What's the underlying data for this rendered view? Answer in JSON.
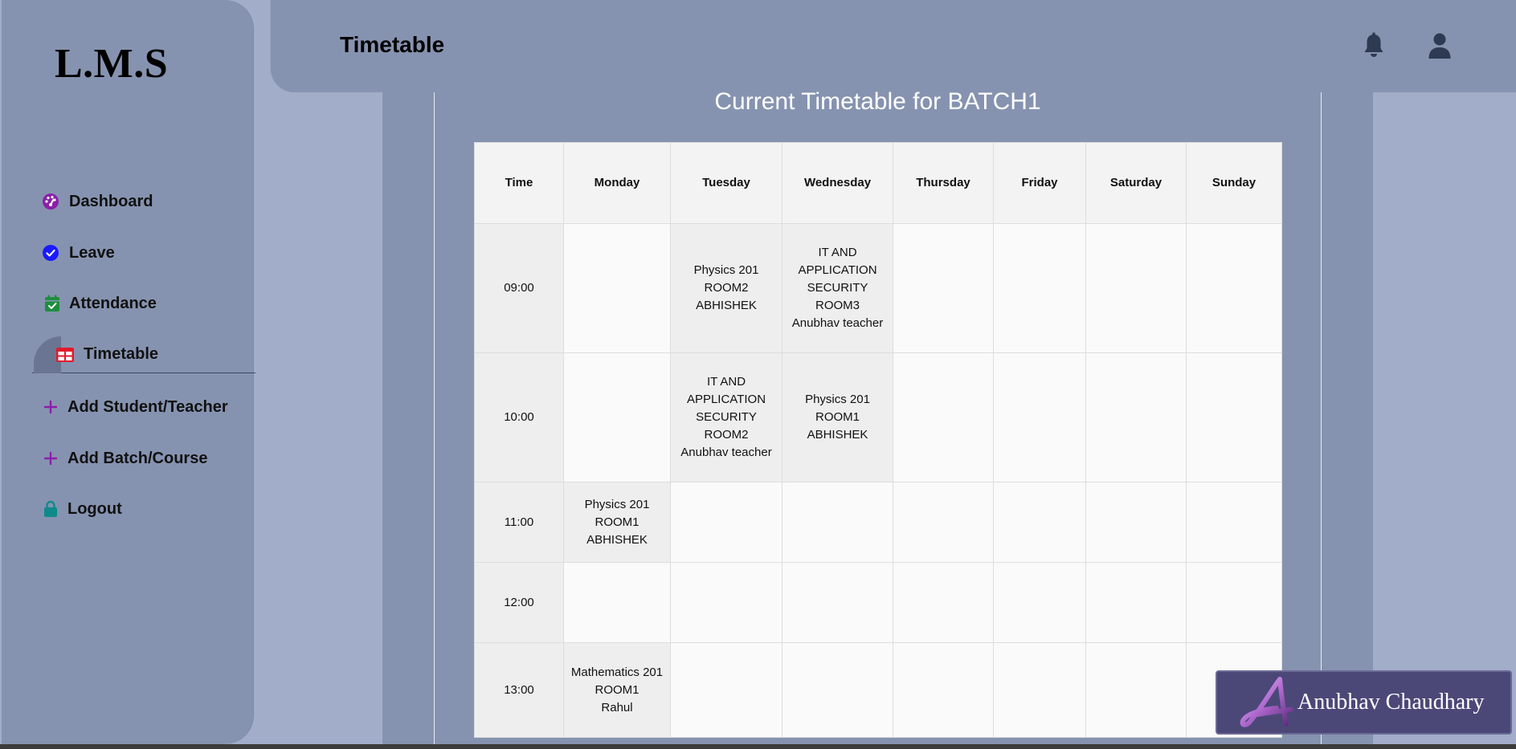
{
  "app": {
    "logo": "L.M.S"
  },
  "sidebar": {
    "items": [
      {
        "label": "Dashboard",
        "icon": "dashboard-icon",
        "color": "#8b1fa9"
      },
      {
        "label": "Leave",
        "icon": "check-circle-icon",
        "color": "#1a1aff"
      },
      {
        "label": "Attendance",
        "icon": "calendar-check-icon",
        "color": "#1e8e3e"
      },
      {
        "label": "Timetable",
        "icon": "table-icon",
        "color": "#e01b2b",
        "active": true
      },
      {
        "label": "Add Student/Teacher",
        "icon": "plus-icon",
        "color": "#8b1fa9"
      },
      {
        "label": "Add Batch/Course",
        "icon": "plus-icon",
        "color": "#8b1fa9"
      },
      {
        "label": "Logout",
        "icon": "lock-icon",
        "color": "#0f8a8a"
      }
    ]
  },
  "header": {
    "title": "Timetable",
    "icons": [
      "bell-icon",
      "user-icon"
    ]
  },
  "timetable": {
    "title": "Current Timetable for BATCH1",
    "columns": [
      "Time",
      "Monday",
      "Tuesday",
      "Wednesday",
      "Thursday",
      "Friday",
      "Saturday",
      "Sunday"
    ],
    "rows": [
      {
        "time": "09:00",
        "cells": [
          "",
          "Physics 201\nROOM2\nABHISHEK",
          "IT AND APPLICATION SECURITY\nROOM3\nAnubhav teacher",
          "",
          "",
          "",
          ""
        ]
      },
      {
        "time": "10:00",
        "cells": [
          "",
          "IT AND APPLICATION SECURITY\nROOM2\nAnubhav teacher",
          "Physics 201\nROOM1\nABHISHEK",
          "",
          "",
          "",
          ""
        ]
      },
      {
        "time": "11:00",
        "cells": [
          "Physics 201\nROOM1\nABHISHEK",
          "",
          "",
          "",
          "",
          "",
          ""
        ]
      },
      {
        "time": "12:00",
        "cells": [
          "",
          "",
          "",
          "",
          "",
          "",
          ""
        ]
      },
      {
        "time": "13:00",
        "cells": [
          "Mathematics 201\nROOM1\nRahul",
          "",
          "",
          "",
          "",
          "",
          ""
        ]
      }
    ]
  },
  "signature": {
    "name": "Anubhav Chaudhary"
  }
}
